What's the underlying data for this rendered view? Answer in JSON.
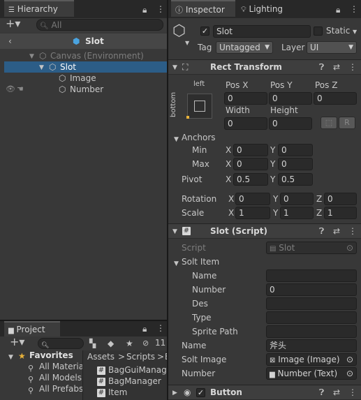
{
  "colors": {
    "selection": "#2c5d87",
    "panel": "#383838",
    "tabbar": "#282828",
    "field": "#2a2a2a",
    "accent": "#4aa3df"
  },
  "hierarchy": {
    "tab_label": "Hierarchy",
    "search_placeholder": "All",
    "scene_title": "Slot",
    "items": [
      {
        "label": "Canvas (Environment)",
        "depth": 0,
        "dim": true
      },
      {
        "label": "Slot",
        "depth": 1,
        "selected": true
      },
      {
        "label": "Image",
        "depth": 2
      },
      {
        "label": "Number",
        "depth": 2
      }
    ]
  },
  "project": {
    "tab_label": "Project",
    "badge_count": "11",
    "favorites": {
      "label": "Favorites",
      "items": [
        "All Materia",
        "All Models",
        "All Prefabs"
      ]
    },
    "breadcrumb": [
      "Assets",
      "Scripts",
      "B"
    ],
    "files": [
      "BagGuiManager",
      "BagManager",
      "Item"
    ]
  },
  "inspector": {
    "tabs": [
      "Inspector",
      "Lighting"
    ],
    "object": {
      "name": "Slot",
      "active": true,
      "static_label": "Static",
      "tag_label": "Tag",
      "tag_value": "Untagged",
      "layer_label": "Layer",
      "layer_value": "UI"
    },
    "rect_transform": {
      "title": "Rect Transform",
      "anchor_h": "left",
      "anchor_v": "bottom",
      "pos_x_label": "Pos X",
      "pos_y_label": "Pos Y",
      "pos_z_label": "Pos Z",
      "pos_x": "0",
      "pos_y": "0",
      "pos_z": "0",
      "width_label": "Width",
      "height_label": "Height",
      "width": "0",
      "height": "0",
      "r_button": "R",
      "anchors_label": "Anchors",
      "min_label": "Min",
      "min_x": "0",
      "min_y": "0",
      "max_label": "Max",
      "max_x": "0",
      "max_y": "0",
      "pivot_label": "Pivot",
      "pivot_x": "0.5",
      "pivot_y": "0.5",
      "rotation_label": "Rotation",
      "rot_x": "0",
      "rot_y": "0",
      "rot_z": "0",
      "scale_label": "Scale",
      "scale_x": "1",
      "scale_y": "1",
      "scale_z": "1",
      "axis_x": "X",
      "axis_y": "Y",
      "axis_z": "Z"
    },
    "slot_script": {
      "title": "Slot (Script)",
      "script_label": "Script",
      "script_value": "Slot",
      "solt_item_label": "Solt Item",
      "fields": [
        {
          "label": "Name",
          "value": ""
        },
        {
          "label": "Number",
          "value": "0"
        },
        {
          "label": "Des",
          "value": ""
        },
        {
          "label": "Type",
          "value": ""
        },
        {
          "label": "Sprite Path",
          "value": ""
        }
      ],
      "name_label": "Name",
      "name_value": "斧头",
      "solt_image_label": "Solt Image",
      "solt_image_value": "Image (Image)",
      "number_label": "Number",
      "number_value": "Number (Text)"
    },
    "button_component": {
      "title": "Button",
      "enabled": true
    }
  }
}
